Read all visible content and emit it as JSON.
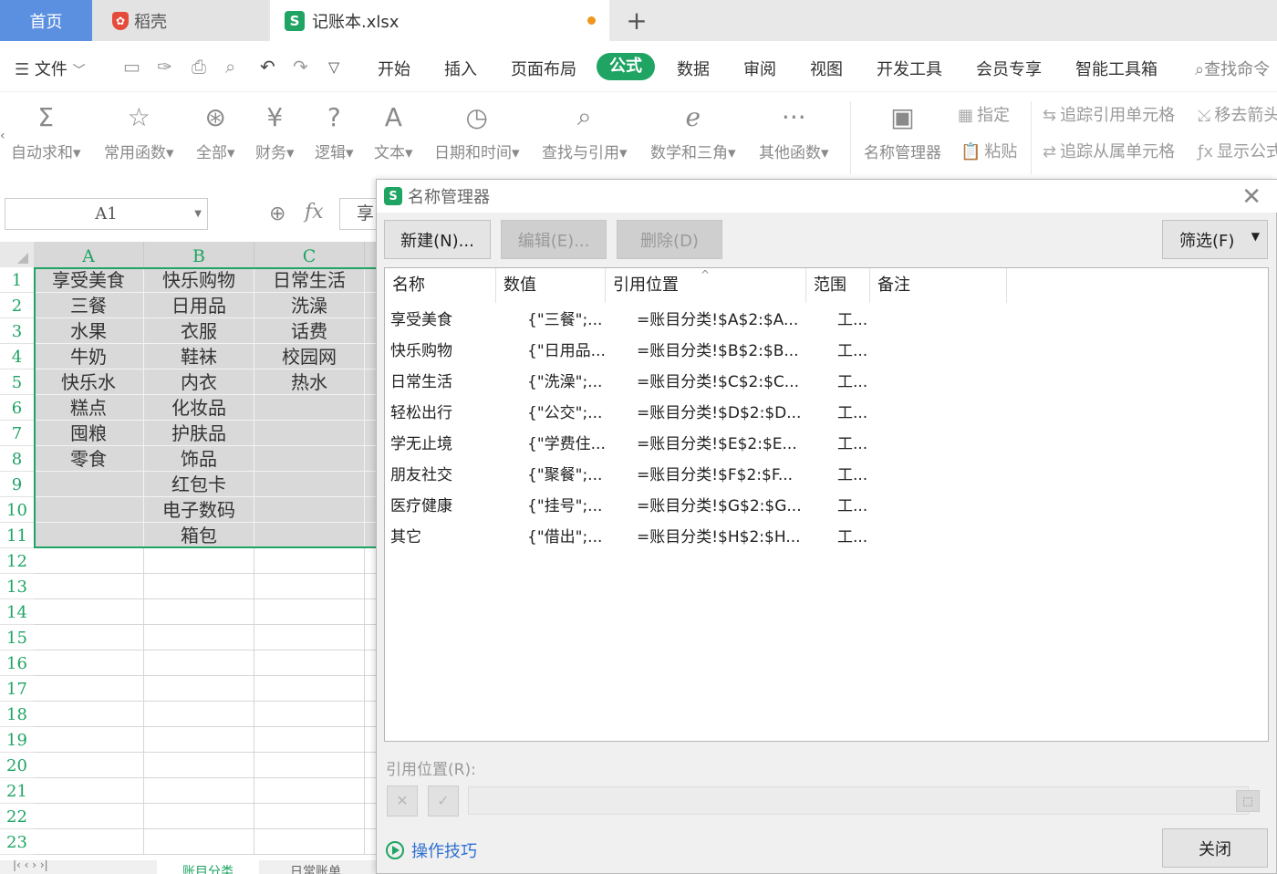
{
  "tabs": {
    "home": "首页",
    "daoke": "稻壳",
    "file": "记账本.xlsx",
    "new": "+"
  },
  "menu": {
    "file": "文件",
    "items": [
      "开始",
      "插入",
      "页面布局",
      "公式",
      "数据",
      "审阅",
      "视图",
      "开发工具",
      "会员专享",
      "智能工具箱"
    ],
    "search": "查找命令"
  },
  "ribbon": {
    "buttons": [
      "自动求和",
      "常用函数",
      "全部",
      "财务",
      "逻辑",
      "文本",
      "日期和时间",
      "查找与引用",
      "数学和三角",
      "其他函数",
      "名称管理器"
    ],
    "define": "指定",
    "paste": "粘贴",
    "trace_precedents": "追踪引用单元格",
    "trace_dependents": "追踪从属单元格",
    "remove_arrows": "移去箭头",
    "show_formulas": "显示公式"
  },
  "formula_bar": {
    "name_box": "A1",
    "fx": "fx",
    "value": "享受美食"
  },
  "sheet": {
    "columns": [
      "A",
      "B",
      "C"
    ],
    "rows": [
      "1",
      "2",
      "3",
      "4",
      "5",
      "6",
      "7",
      "8",
      "9",
      "10",
      "11",
      "12",
      "13",
      "14",
      "15",
      "16",
      "17",
      "18",
      "19",
      "20",
      "21",
      "22",
      "23"
    ],
    "cells": [
      [
        "享受美食",
        "快乐购物",
        "日常生活"
      ],
      [
        "三餐",
        "日用品",
        "洗澡"
      ],
      [
        "水果",
        "衣服",
        "话费"
      ],
      [
        "牛奶",
        "鞋袜",
        "校园网"
      ],
      [
        "快乐水",
        "内衣",
        "热水"
      ],
      [
        "糕点",
        "化妆品",
        ""
      ],
      [
        "囤粮",
        "护肤品",
        ""
      ],
      [
        "零食",
        "饰品",
        ""
      ],
      [
        "",
        "红包卡",
        ""
      ],
      [
        "",
        "电子数码",
        ""
      ],
      [
        "",
        "箱包",
        ""
      ]
    ],
    "tabs": [
      "账目分类",
      "日常账单"
    ]
  },
  "dialog": {
    "title": "名称管理器",
    "new": "新建(N)...",
    "edit": "编辑(E)...",
    "delete": "删除(D)",
    "filter": "筛选(F)",
    "headers": [
      "名称",
      "数值",
      "引用位置",
      "范围",
      "备注"
    ],
    "rows": [
      [
        "享受美食",
        "{\"三餐\";...",
        "=账目分类!$A$2:$A...",
        "工..."
      ],
      [
        "快乐购物",
        "{\"日用品...",
        "=账目分类!$B$2:$B...",
        "工..."
      ],
      [
        "日常生活",
        "{\"洗澡\";...",
        "=账目分类!$C$2:$C...",
        "工..."
      ],
      [
        "轻松出行",
        "{\"公交\";...",
        "=账目分类!$D$2:$D...",
        "工..."
      ],
      [
        "学无止境",
        "{\"学费住...",
        "=账目分类!$E$2:$E...",
        "工..."
      ],
      [
        "朋友社交",
        "{\"聚餐\";...",
        "=账目分类!$F$2:$F...",
        "工..."
      ],
      [
        "医疗健康",
        "{\"挂号\";...",
        "=账目分类!$G$2:$G...",
        "工..."
      ],
      [
        "其它",
        "{\"借出\";...",
        "=账目分类!$H$2:$H...",
        "工..."
      ]
    ],
    "ref_label": "引用位置(R):",
    "tips": "操作技巧",
    "close": "关闭"
  }
}
